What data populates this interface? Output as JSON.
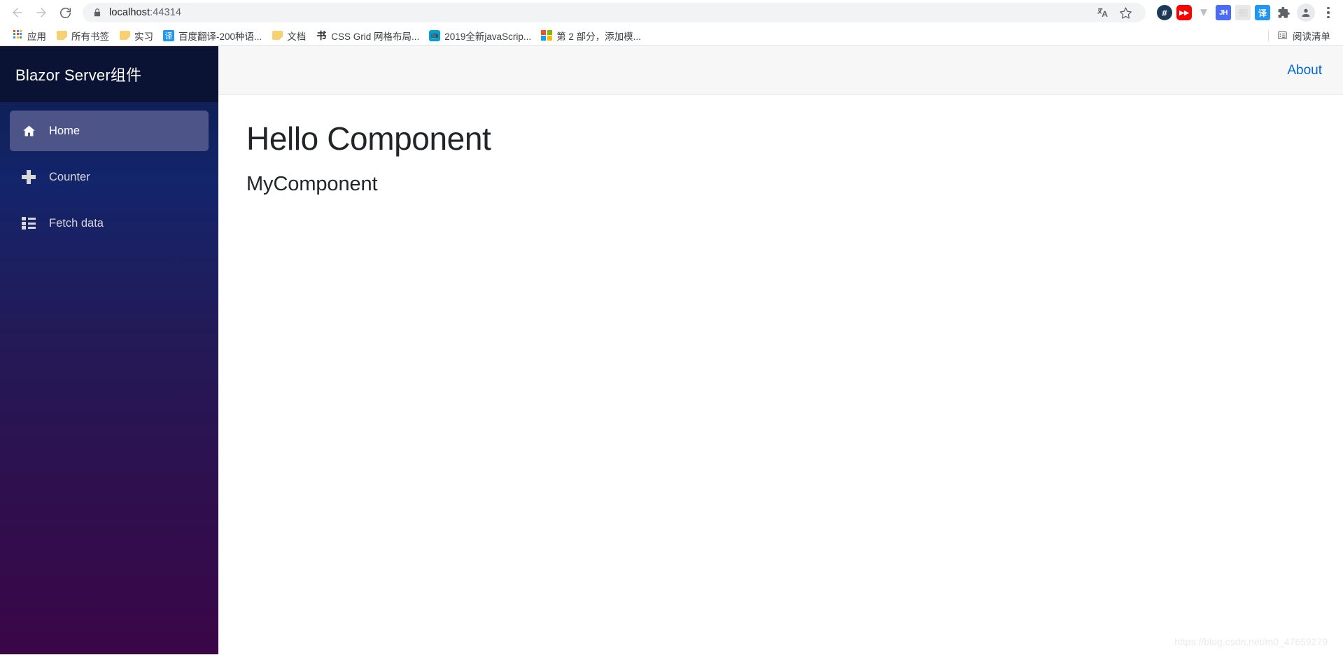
{
  "browser": {
    "back_tooltip": "Back",
    "forward_tooltip": "Forward",
    "reload_tooltip": "Reload",
    "url_host": "localhost",
    "url_port": ":44314",
    "translate_icon": "translate-icon",
    "bookmark_icon": "star-icon",
    "profile_icon": "profile-avatar-icon",
    "menu_icon": "kebab-menu-icon",
    "extensions": [
      {
        "name": "hash-extension-icon",
        "glyph": "#"
      },
      {
        "name": "youtube-extension-icon",
        "glyph": "▶▶"
      },
      {
        "name": "vue-devtools-extension-icon",
        "glyph": "▼"
      },
      {
        "name": "jh-extension-icon",
        "glyph": "JH"
      },
      {
        "name": "qrcode-extension-icon",
        "glyph": "░░"
      },
      {
        "name": "translate-extension-icon",
        "glyph": "译"
      },
      {
        "name": "puzzle-extensions-icon",
        "glyph": ""
      }
    ]
  },
  "bookmarks": {
    "items": [
      {
        "label": "应用",
        "icon": "apps-grid-icon"
      },
      {
        "label": "所有书签",
        "icon": "folder-icon"
      },
      {
        "label": "实习",
        "icon": "folder-icon"
      },
      {
        "label": "百度翻译-200种语...",
        "icon": "baidu-translate-icon"
      },
      {
        "label": "文档",
        "icon": "folder-icon"
      },
      {
        "label": "CSS Grid 网格布局...",
        "icon": "shu-calligraphy-icon"
      },
      {
        "label": "2019全新javaScrip...",
        "icon": "bilibili-icon"
      },
      {
        "label": "第 2 部分，添加模...",
        "icon": "microsoft-icon"
      }
    ],
    "reading_list": {
      "label": "阅读清单",
      "icon": "reading-list-icon"
    }
  },
  "app": {
    "brand": "Blazor Server组件",
    "nav": [
      {
        "label": "Home",
        "icon": "home-icon",
        "active": true
      },
      {
        "label": "Counter",
        "icon": "plus-icon",
        "active": false
      },
      {
        "label": "Fetch data",
        "icon": "list-icon",
        "active": false
      }
    ],
    "topbar": {
      "about_label": "About"
    },
    "main": {
      "title": "Hello Component",
      "subtitle": "MyComponent"
    },
    "watermark": "https://blog.csdn.net/m0_47659279"
  },
  "colors": {
    "sidebar_top": "#0d1b48",
    "sidebar_bottom": "#3a0647",
    "active_nav": "#4c5488",
    "link": "#0366d6",
    "topbar_bg": "#f7f7f7"
  }
}
